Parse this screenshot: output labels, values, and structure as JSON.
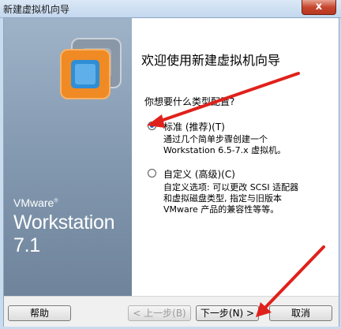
{
  "window": {
    "title": "新建虚拟机向导",
    "close_label": "x"
  },
  "sidebar": {
    "brand": "VMware",
    "product": "Workstation 7.1"
  },
  "content": {
    "heading": "欢迎使用新建虚拟机向导",
    "question": "你想要什么类型配置?",
    "options": [
      {
        "label": "标准 (推荐)(T)",
        "checked": true,
        "description": [
          "通过几个简单步骤创建一个",
          "Workstation 6.5-7.x 虚拟机。"
        ]
      },
      {
        "label": "自定义 (高级)(C)",
        "checked": false,
        "description": [
          "自定义选项: 可以更改 SCSI 适配器",
          "和虚拟磁盘类型, 指定与旧版本",
          "VMware 产品的兼容性等等。"
        ]
      }
    ]
  },
  "buttons": {
    "help": "帮助",
    "back": "< 上一步(B)",
    "next": "下一步(N) >",
    "cancel": "取消"
  },
  "colors": {
    "arrow": "#e0211b",
    "sidebar": "#8399b0",
    "accent": "#1f5fb0"
  }
}
